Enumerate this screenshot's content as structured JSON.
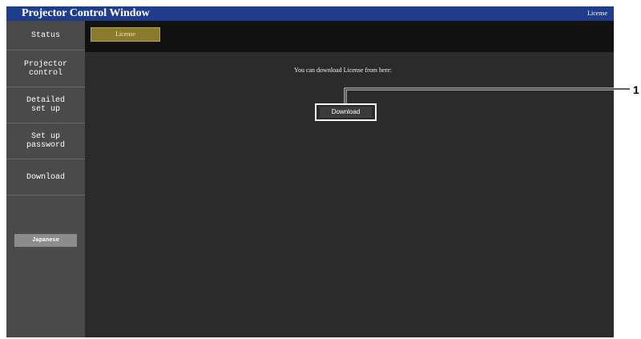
{
  "header": {
    "title": "Projector Control Window",
    "license_link": "License"
  },
  "sidebar": {
    "items": [
      {
        "label": "Status"
      },
      {
        "label": "Projector\ncontrol"
      },
      {
        "label": "Detailed\nset up"
      },
      {
        "label": "Set up\npassword"
      },
      {
        "label": "Download"
      }
    ],
    "language_button": "Japanese"
  },
  "tabs": [
    {
      "label": "License",
      "selected": true
    }
  ],
  "main": {
    "message": "You can download License from here:",
    "download_button": "Download"
  },
  "callout": {
    "number": "1"
  },
  "colors": {
    "title_bar": "#1f3d8a",
    "sidebar": "#4a4a4a",
    "content": "#2b2b2b",
    "tab_bar": "#111111",
    "active_tab": "#8a7a2c"
  }
}
